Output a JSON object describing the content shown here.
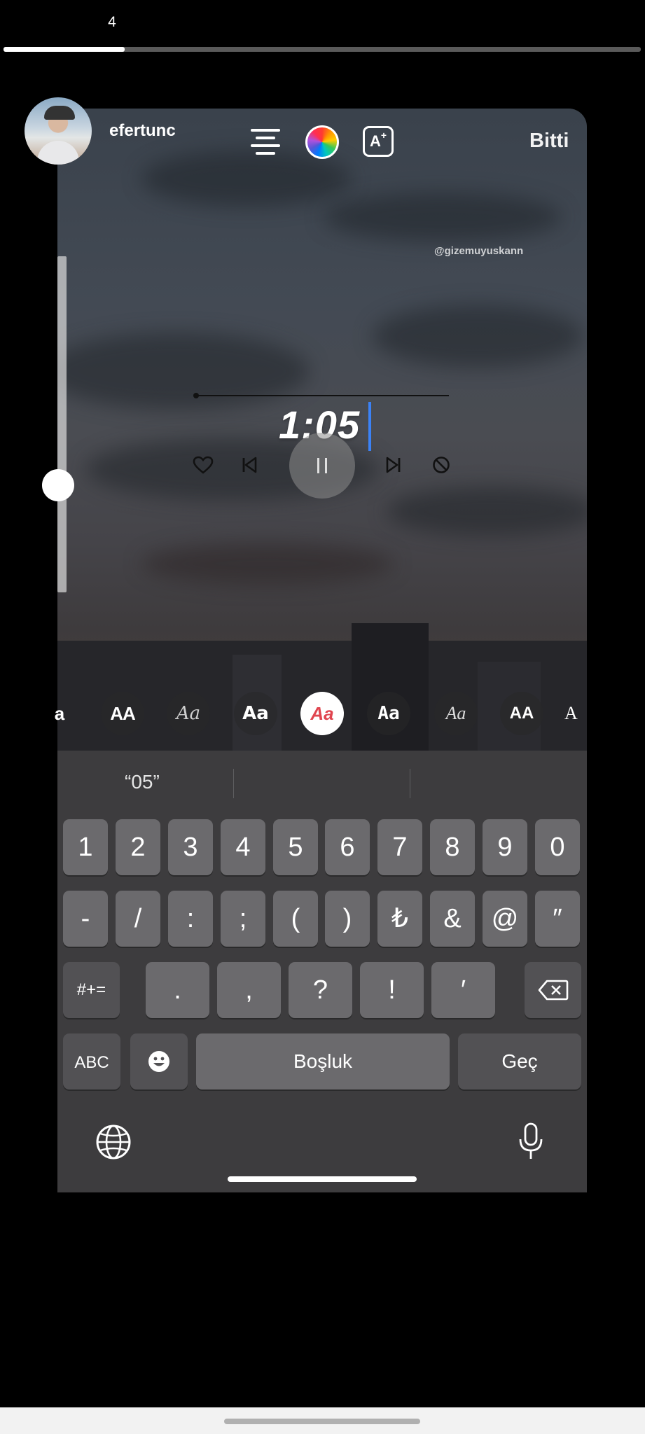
{
  "story": {
    "counter": "4",
    "progress_fraction": 0.19,
    "username": "efertunc",
    "done_label": "Bitti",
    "watermark": "@gizemuyuskann"
  },
  "toolbar": {
    "align_icon": "align-center-icon",
    "color_icon": "color-wheel-icon",
    "effect_label": "A",
    "effect_plus": "+"
  },
  "music": {
    "time": "1:05"
  },
  "fonts": {
    "items": [
      {
        "label": "a",
        "style": "bold"
      },
      {
        "label": "AA",
        "style": "condensed"
      },
      {
        "label": "Aa",
        "style": "script"
      },
      {
        "label": "Aa",
        "style": "bold-sans"
      },
      {
        "label": "Aa",
        "style": "selected"
      },
      {
        "label": "Aa",
        "style": "rounded"
      },
      {
        "label": "Aa",
        "style": "serif-italic"
      },
      {
        "label": "AA",
        "style": "caps"
      },
      {
        "label": "A",
        "style": "serif"
      }
    ]
  },
  "keyboard": {
    "suggestion": "“05”",
    "row1": [
      "1",
      "2",
      "3",
      "4",
      "5",
      "6",
      "7",
      "8",
      "9",
      "0"
    ],
    "row2": [
      "-",
      "/",
      ":",
      ";",
      "(",
      ")",
      "₺",
      "&",
      "@",
      "″"
    ],
    "row3_toggle": "#+=",
    "row3": [
      ".",
      ",",
      "?",
      "!",
      "′"
    ],
    "abc_label": "ABC",
    "space_label": "Boşluk",
    "return_label": "Geç"
  }
}
